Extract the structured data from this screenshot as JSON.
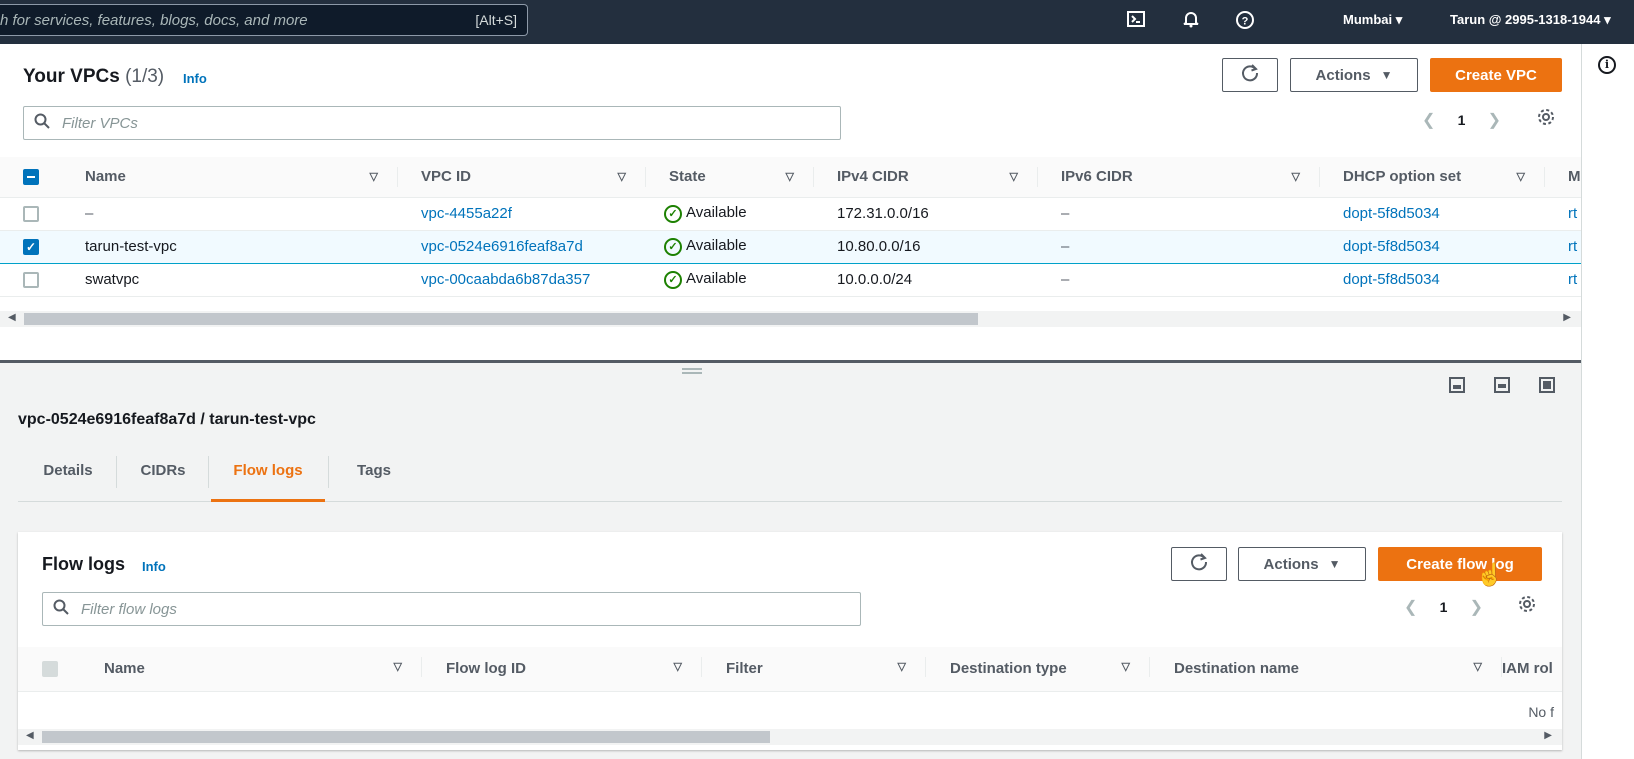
{
  "topnav": {
    "search_placeholder": "h for services, features, blogs, docs, and more",
    "search_shortcut": "[Alt+S]",
    "icons": [
      "cloudshell-icon",
      "bell-icon",
      "help-icon"
    ],
    "region": "Mumbai",
    "account": "Tarun @ 2995-1318-1944"
  },
  "vpc_panel": {
    "title": "Your VPCs",
    "count": "(1/3)",
    "info": "Info",
    "actions_label": "Actions",
    "create_label": "Create VPC",
    "filter_placeholder": "Filter VPCs",
    "page": "1",
    "columns": [
      "Name",
      "VPC ID",
      "State",
      "IPv4 CIDR",
      "IPv6 CIDR",
      "DHCP option set",
      "M"
    ],
    "rows": [
      {
        "selected": false,
        "name": "–",
        "vpc_id": "vpc-4455a22f",
        "state": "Available",
        "ipv4": "172.31.0.0/16",
        "ipv6": "–",
        "dhcp": "dopt-5f8d5034",
        "more": "rt"
      },
      {
        "selected": true,
        "name": "tarun-test-vpc",
        "vpc_id": "vpc-0524e6916feaf8a7d",
        "state": "Available",
        "ipv4": "10.80.0.0/16",
        "ipv6": "–",
        "dhcp": "dopt-5f8d5034",
        "more": "rt"
      },
      {
        "selected": false,
        "name": "swatvpc",
        "vpc_id": "vpc-00caabda6b87da357",
        "state": "Available",
        "ipv4": "10.0.0.0/24",
        "ipv6": "–",
        "dhcp": "dopt-5f8d5034",
        "more": "rt"
      }
    ]
  },
  "details": {
    "title": "vpc-0524e6916feaf8a7d / tarun-test-vpc",
    "tabs": [
      "Details",
      "CIDRs",
      "Flow logs",
      "Tags"
    ],
    "active_tab": "Flow logs"
  },
  "flow_panel": {
    "title": "Flow logs",
    "info": "Info",
    "actions_label": "Actions",
    "create_label": "Create flow log",
    "filter_placeholder": "Filter flow logs",
    "page": "1",
    "columns": [
      "Name",
      "Flow log ID",
      "Filter",
      "Destination type",
      "Destination name",
      "IAM rol"
    ],
    "empty_text": "No f"
  },
  "colors": {
    "accent": "#ec7211",
    "link": "#0073bb",
    "success": "#1d8102",
    "nav_bg": "#232f3e"
  }
}
